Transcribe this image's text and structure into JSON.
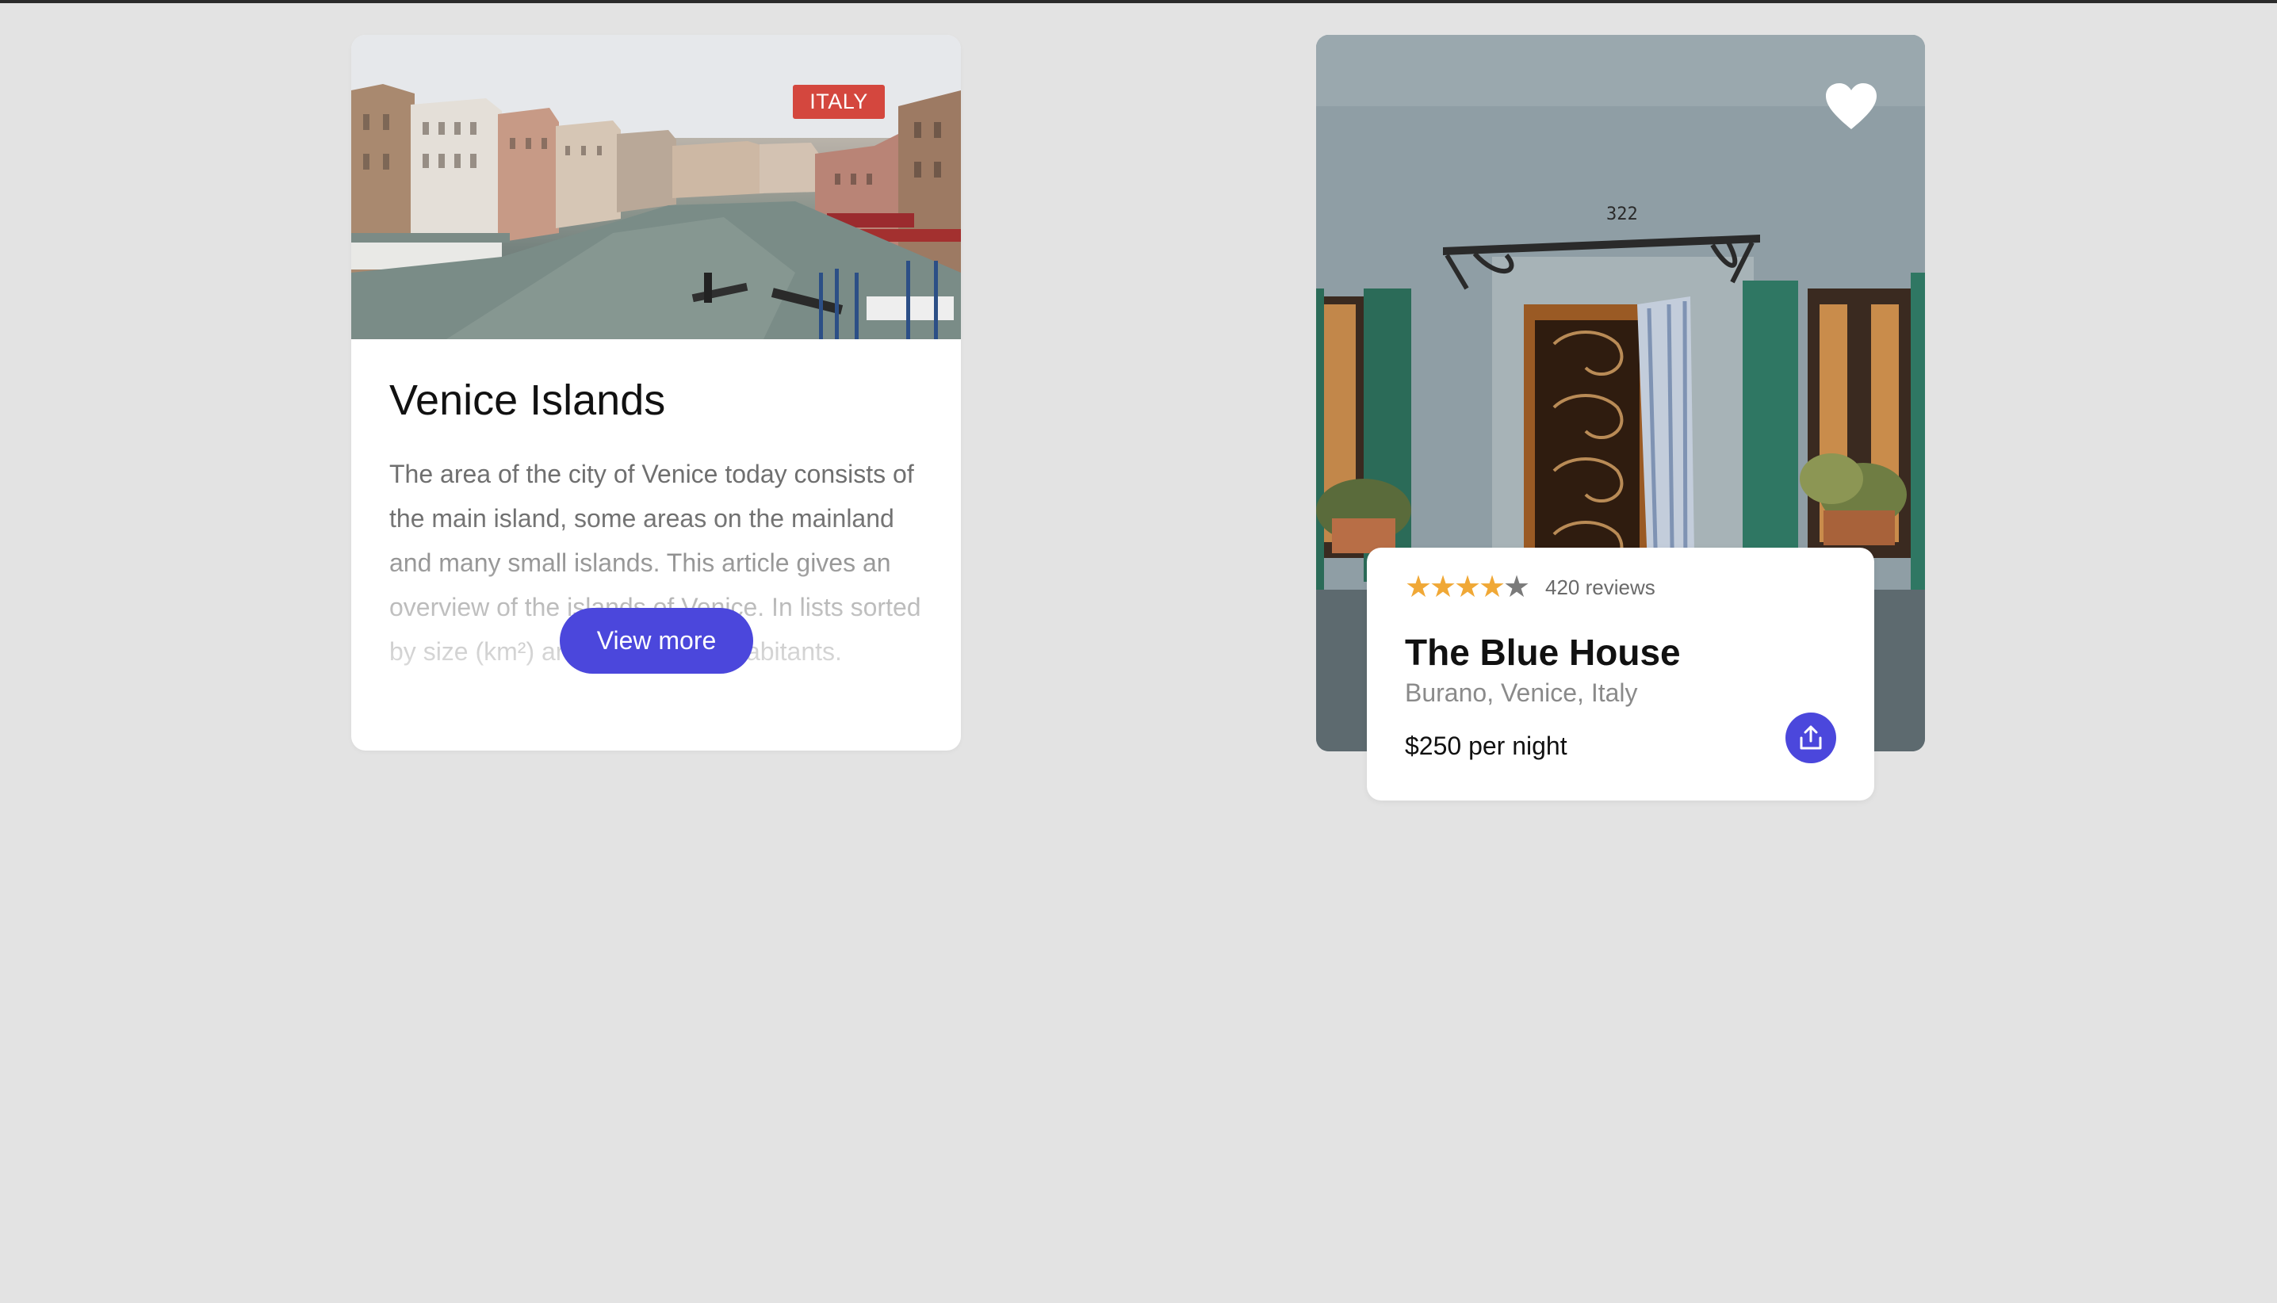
{
  "venice_card": {
    "badge": "ITALY",
    "title": "Venice Islands",
    "description": "The area of the city of Venice today consists of the main island, some areas on the mainland and many small islands. This article gives an overview of the islands of Venice. In lists sorted by size (km²) and number of inhabitants.",
    "button_label": "View more",
    "badge_color": "#d4473e",
    "accent_color": "#4b47dc"
  },
  "house_card": {
    "rating": 4,
    "rating_max": 5,
    "reviews": "420 reviews",
    "title": "The Blue House",
    "location": "Burano, Venice, Italy",
    "price": "$250 per night",
    "star_color": "#f0a836",
    "icons": {
      "favorite": "heart-icon",
      "share": "share-upload-icon",
      "rating": "star-icon"
    }
  }
}
